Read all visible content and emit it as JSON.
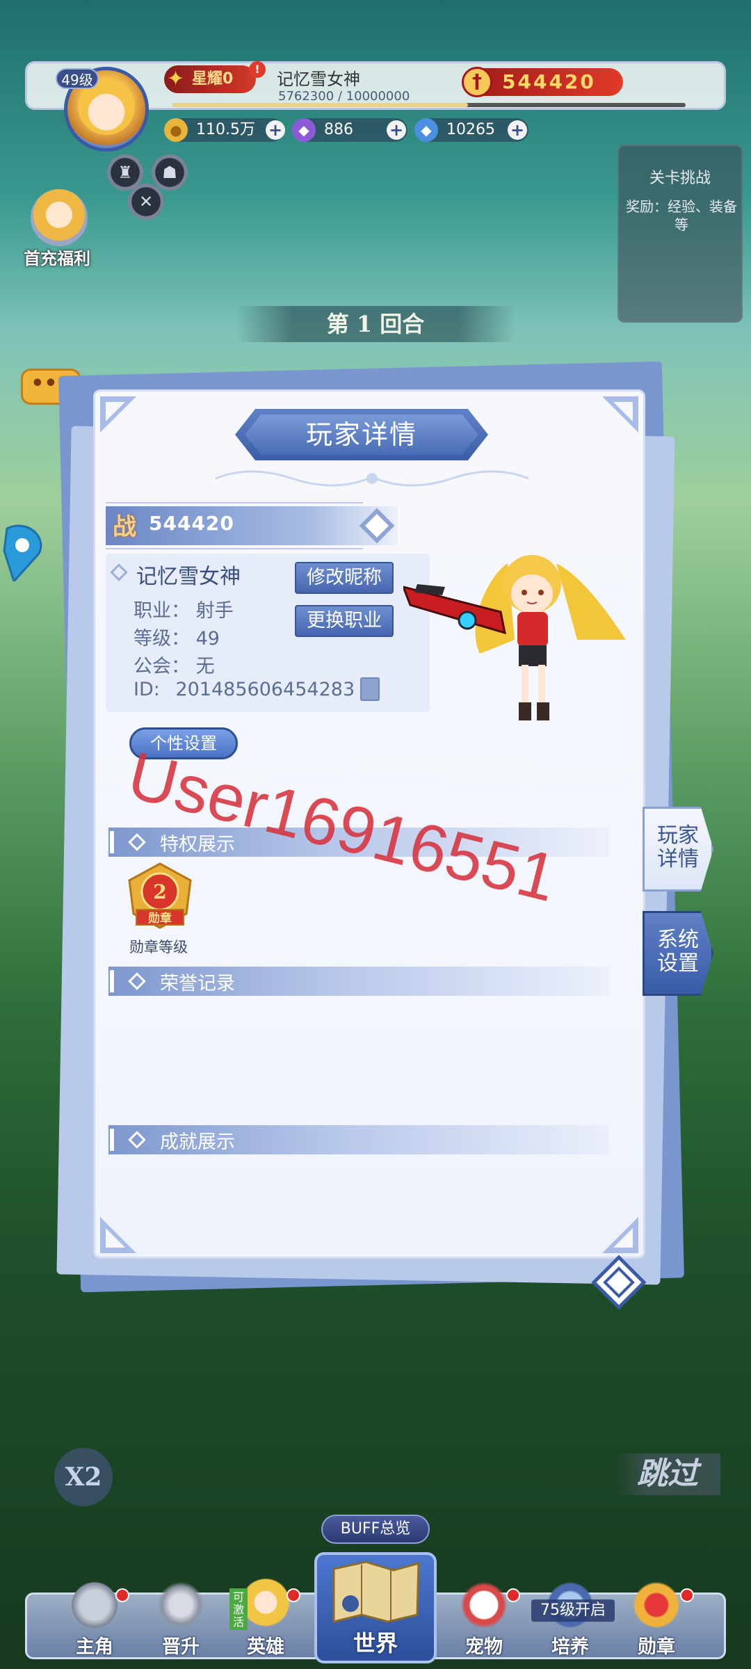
{
  "hud": {
    "level": "49级",
    "honor_label": "星耀0",
    "honor_dot": "!",
    "player_name": "记忆雪女神",
    "exp_text": "5762300 / 10000000",
    "exp_progress": 0.576,
    "power": "544420",
    "resources": [
      {
        "icon": "gold-coin-icon",
        "value": "110.5万"
      },
      {
        "icon": "purple-gem-icon",
        "value": "886"
      },
      {
        "icon": "blue-diamond-icon",
        "value": "10265"
      }
    ],
    "welfare_label": "首充福利"
  },
  "stage_panel": {
    "title": "关卡挑战",
    "reward": "奖励：经验、装备等"
  },
  "round_banner": "第 1 回合",
  "chat_bubble": "•••",
  "panel": {
    "title": "玩家详情",
    "power_char": "战",
    "power_value": "544420",
    "nickname": "记忆雪女神",
    "job_label": "职业：",
    "job_value": "射手",
    "level_label": "等级：",
    "level_value": "49",
    "guild_label": "公会：",
    "guild_value": "无",
    "id_label": "ID:",
    "id_value": "201485606454283",
    "rename_button": "修改昵称",
    "change_job_button": "更换职业",
    "custom_button": "个性设置",
    "sections": {
      "privilege": "特权展示",
      "honor": "荣誉记录",
      "achievement": "成就展示"
    },
    "medal_value": "2",
    "medal_ribbon": "勋章",
    "medal_caption": "勋章等级",
    "watermark": "User16916551"
  },
  "side_tabs": [
    {
      "label": "玩家详情"
    },
    {
      "label": "系统设置"
    }
  ],
  "bottom": {
    "speed": "X2",
    "skip": "跳过",
    "buff_label": "BUFF总览",
    "can_activate": "可激活",
    "unlock_tag": "75级开启",
    "nav": [
      {
        "label": "主角"
      },
      {
        "label": "晋升"
      },
      {
        "label": "英雄"
      },
      {
        "label": "世界"
      },
      {
        "label": "宠物"
      },
      {
        "label": "培养"
      },
      {
        "label": "勋章"
      }
    ]
  },
  "colors": {
    "panel_blue": "#4766b0",
    "power_red": "#d23a2a",
    "watermark": "#d6323e"
  }
}
